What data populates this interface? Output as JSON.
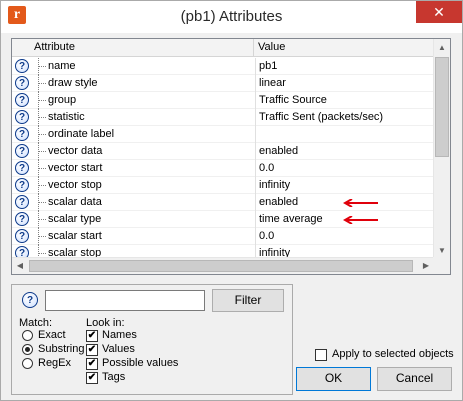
{
  "window": {
    "title": "(pb1) Attributes",
    "app_icon": "r",
    "close_glyph": "✕"
  },
  "table": {
    "headers": {
      "attribute": "Attribute",
      "value": "Value"
    },
    "rows": [
      {
        "name": "name",
        "value": "pb1"
      },
      {
        "name": "draw style",
        "value": "linear"
      },
      {
        "name": "group",
        "value": "Traffic Source"
      },
      {
        "name": "statistic",
        "value": "Traffic Sent (packets/sec)"
      },
      {
        "name": "ordinate label",
        "value": ""
      },
      {
        "name": "vector data",
        "value": "enabled"
      },
      {
        "name": "vector start",
        "value": "0.0"
      },
      {
        "name": "vector stop",
        "value": "infinity"
      },
      {
        "name": "scalar data",
        "value": "enabled"
      },
      {
        "name": "scalar type",
        "value": "time average"
      },
      {
        "name": "scalar start",
        "value": "0.0"
      },
      {
        "name": "scalar stop",
        "value": "infinity"
      }
    ],
    "help_glyph": "?",
    "annotation_color": "#e0000b"
  },
  "find": {
    "help_glyph": "?",
    "search_value": "",
    "filter_label": "Filter",
    "match_label": "Match:",
    "match_options": [
      {
        "label": "Exact",
        "checked": false
      },
      {
        "label": "Substring",
        "checked": true
      },
      {
        "label": "RegEx",
        "checked": false
      }
    ],
    "lookin_label": "Look in:",
    "lookin_options": [
      {
        "label": "Names",
        "checked": true
      },
      {
        "label": "Values",
        "checked": true
      },
      {
        "label": "Possible values",
        "checked": true
      },
      {
        "label": "Tags",
        "checked": true
      }
    ]
  },
  "footer": {
    "apply_label": "Apply to selected objects",
    "apply_checked": false,
    "ok_label": "OK",
    "cancel_label": "Cancel"
  }
}
